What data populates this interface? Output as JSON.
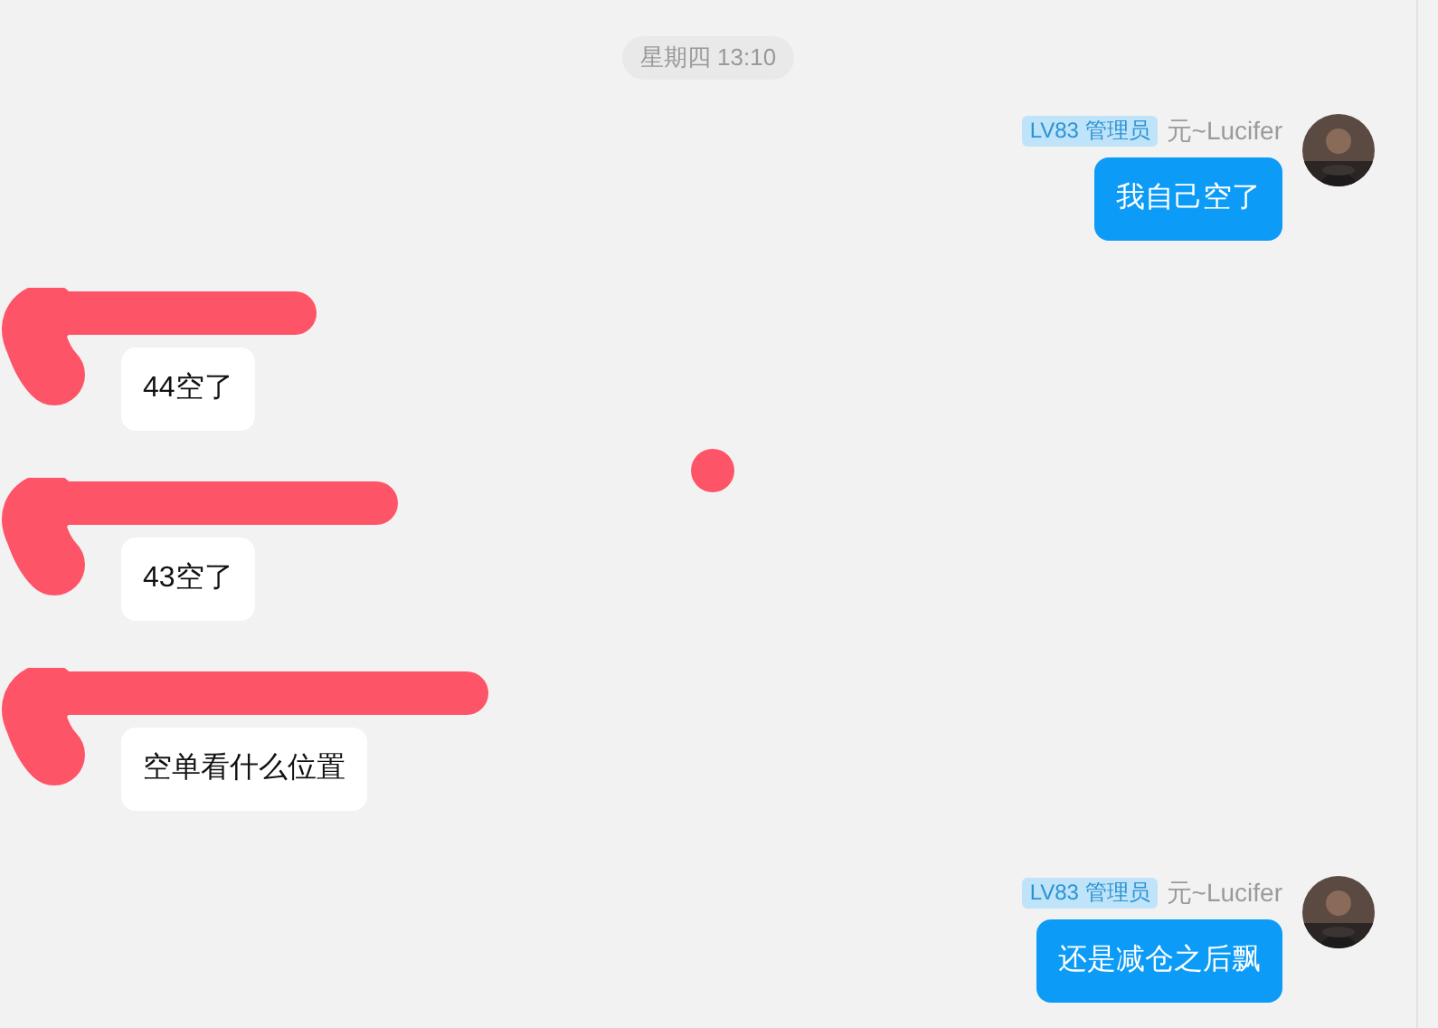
{
  "timestamp": "星期四 13:10",
  "messages": [
    {
      "kind": "outgoing",
      "badge": "LV83 管理员",
      "sender": "元~Lucifer",
      "text": "我自己空了"
    },
    {
      "kind": "incoming",
      "redacted": true,
      "text": "44空了"
    },
    {
      "kind": "incoming",
      "redacted": true,
      "text": "43空了"
    },
    {
      "kind": "incoming",
      "redacted": true,
      "text": "空单看什么位置"
    },
    {
      "kind": "outgoing",
      "badge": "LV83 管理员",
      "sender": "元~Lucifer",
      "text": "还是减仓之后飘"
    }
  ],
  "stray_mark": true
}
